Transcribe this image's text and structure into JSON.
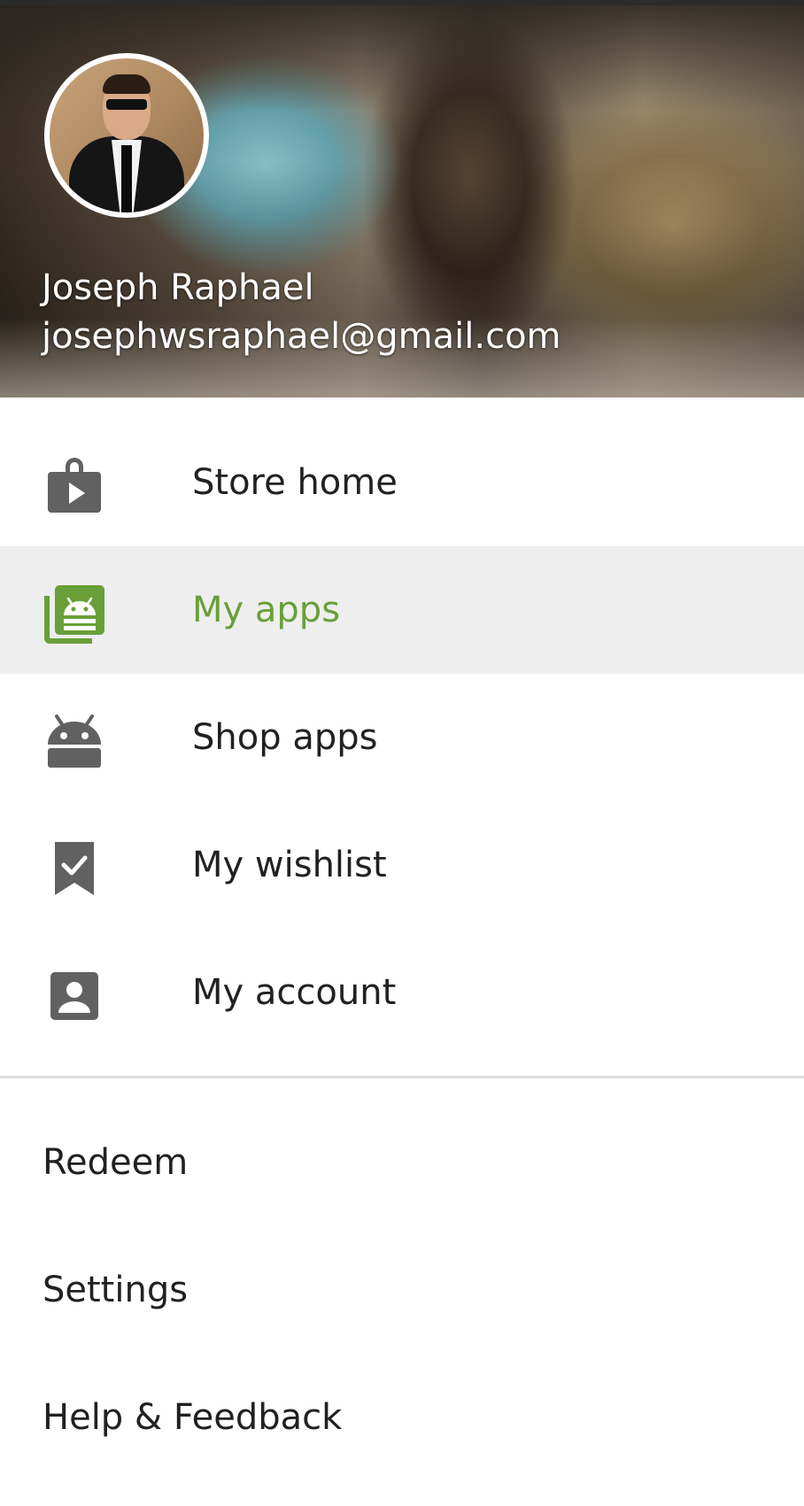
{
  "profile": {
    "name": "Joseph Raphael",
    "email": "josephwsraphael@gmail.com"
  },
  "nav": {
    "store_home": "Store home",
    "my_apps": "My apps",
    "shop_apps": "Shop apps",
    "my_wishlist": "My wishlist",
    "my_account": "My account"
  },
  "secondary": {
    "redeem": "Redeem",
    "settings": "Settings",
    "help_feedback": "Help & Feedback"
  },
  "icons": {
    "store_home": "shopping-bag-play-icon",
    "my_apps": "my-apps-library-icon",
    "shop_apps": "android-icon",
    "my_wishlist": "bookmark-check-icon",
    "my_account": "account-box-icon"
  },
  "colors": {
    "active_accent": "#689f38",
    "active_bg": "#eeeeee",
    "icon_gray": "#616161",
    "text": "#212121"
  }
}
